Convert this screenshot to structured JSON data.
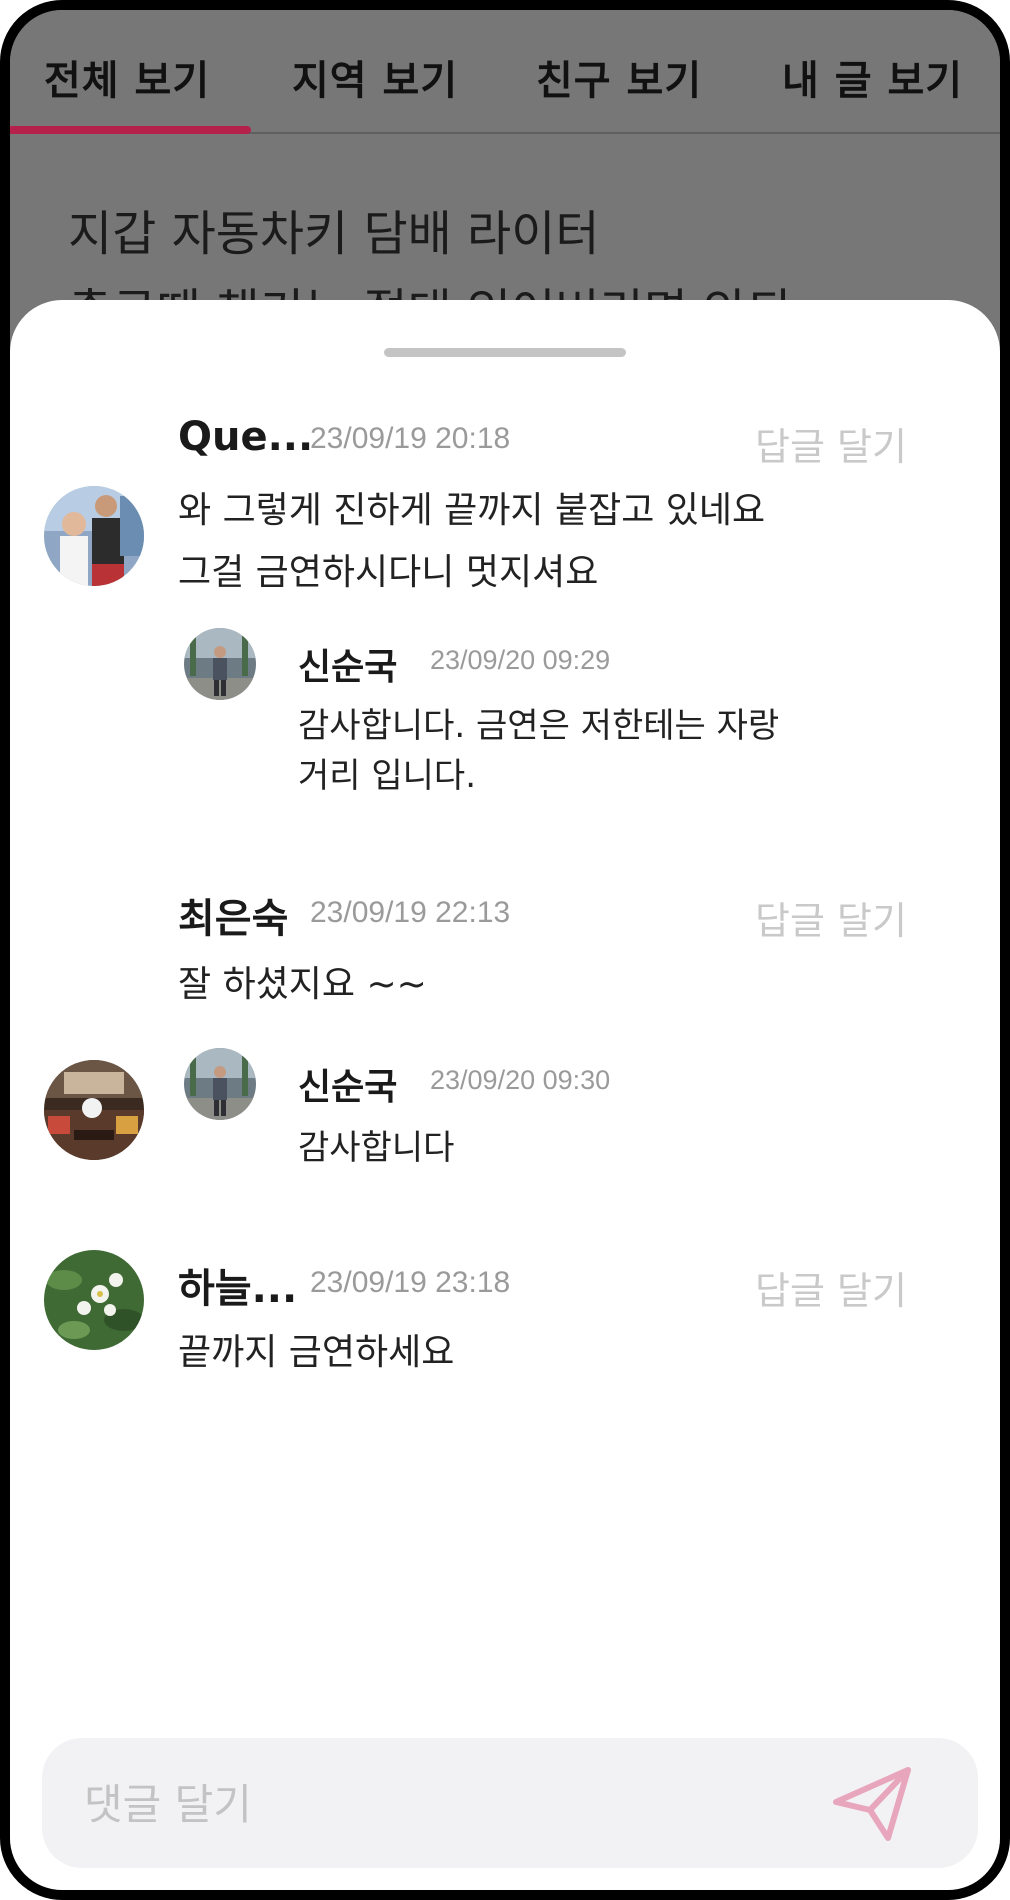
{
  "tabs": [
    {
      "label": "전체 보기",
      "active": true
    },
    {
      "label": "지역 보기",
      "active": false
    },
    {
      "label": "친구 보기",
      "active": false
    },
    {
      "label": "내 글 보기",
      "active": false
    }
  ],
  "post": {
    "line1": "지갑 자동차키 담배 라이터",
    "line2": "출근때 챙기는 절대 잊어버리면 안되"
  },
  "comments": [
    {
      "author": "Que...",
      "time": "23/09/19 20:18",
      "reply_label": "답글 달기",
      "text_lines": [
        "와 그렇게 진하게 끝까지 붙잡고 있네요",
        "그걸 금연하시다니 멋지셔요"
      ],
      "avatar": "photo-two-men-icon",
      "replies": [
        {
          "author": "신순국",
          "time": "23/09/20 09:29",
          "text_lines": [
            "감사합니다. 금연은 저한테는 자랑",
            "거리 입니다."
          ],
          "avatar": "photo-man-street-icon"
        }
      ]
    },
    {
      "author": "최은숙",
      "time": "23/09/19 22:13",
      "reply_label": "답글 달기",
      "text_lines": [
        "잘 하셨지요 ~~"
      ],
      "avatar": "photo-restaurant-icon",
      "replies": [
        {
          "author": "신순국",
          "time": "23/09/20 09:30",
          "text_lines": [
            "감사합니다"
          ],
          "avatar": "photo-man-street-icon"
        }
      ]
    },
    {
      "author": "하늘...",
      "time": "23/09/19 23:18",
      "reply_label": "답글 달기",
      "text_lines": [
        "끝까지  금연하세요"
      ],
      "avatar": "photo-flowers-icon",
      "replies": []
    }
  ],
  "input": {
    "placeholder": "댓글 달기"
  },
  "colors": {
    "accent": "#b5214a",
    "send_icon": "#e8a6bd",
    "muted": "#c9c9c9"
  }
}
